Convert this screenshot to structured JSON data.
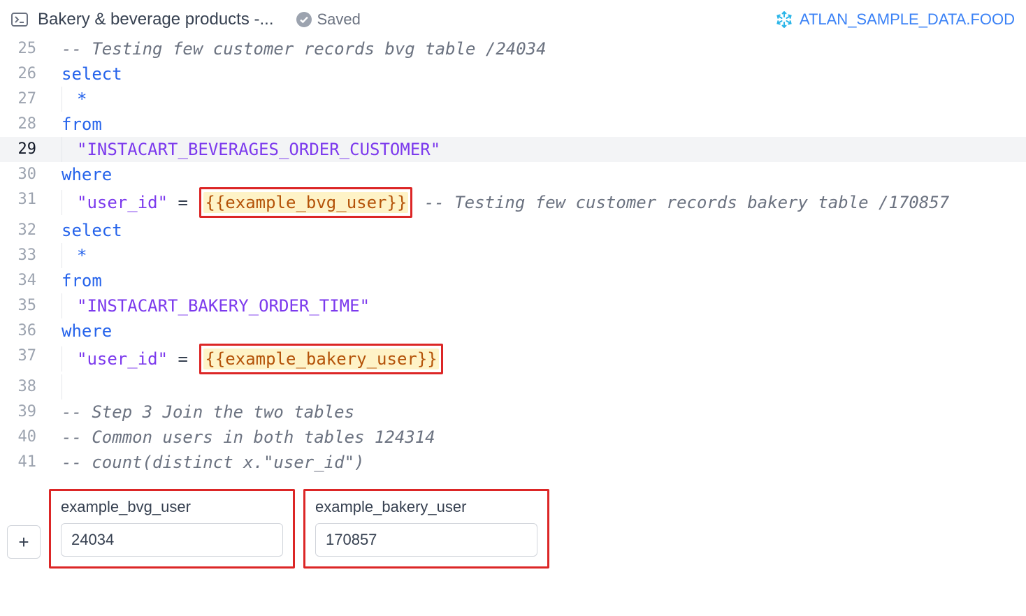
{
  "header": {
    "title": "Bakery & beverage products -...",
    "saved_label": "Saved",
    "connection_label": "ATLAN_SAMPLE_DATA.FOOD"
  },
  "editor": {
    "current_line": 29,
    "lines": {
      "25": {
        "comment": "-- Testing few customer records bvg table /24034"
      },
      "26": {
        "keyword": "select"
      },
      "27": {
        "star": "*"
      },
      "28": {
        "keyword": "from"
      },
      "29": {
        "identifier": "\"INSTACART_BEVERAGES_ORDER_CUSTOMER\""
      },
      "30": {
        "keyword": "where"
      },
      "31": {
        "column": "\"user_id\"",
        "eq": " = ",
        "variable": "{{example_bvg_user}}",
        "trailing_comment": " -- Testing few customer records bakery table /170857"
      },
      "32": {
        "keyword": "select"
      },
      "33": {
        "star": "*"
      },
      "34": {
        "keyword": "from"
      },
      "35": {
        "identifier": "\"INSTACART_BAKERY_ORDER_TIME\""
      },
      "36": {
        "keyword": "where"
      },
      "37": {
        "column": "\"user_id\"",
        "eq": " = ",
        "variable": "{{example_bakery_user}}"
      },
      "38": {
        "blank": ""
      },
      "39": {
        "comment": "-- Step 3 Join the two tables"
      },
      "40": {
        "comment": "-- Common users in both tables 124314"
      },
      "41": {
        "comment": "-- count(distinct x.\"user_id\")"
      }
    }
  },
  "params": [
    {
      "name": "example_bvg_user",
      "value": "24034"
    },
    {
      "name": "example_bakery_user",
      "value": "170857"
    }
  ],
  "add_button": "+"
}
